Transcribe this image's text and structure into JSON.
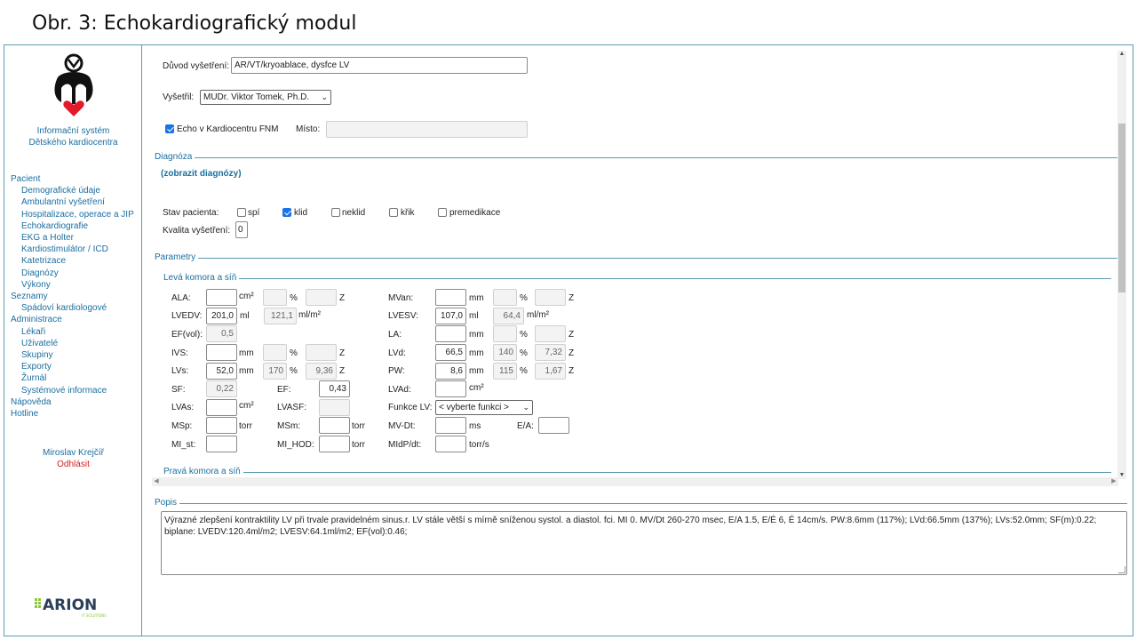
{
  "slide_title": "Obr. 3: Echokardiografický modul",
  "sidebar": {
    "system_title_1": "Informační systém",
    "system_title_2": "Dětského kardiocentra",
    "nav": [
      {
        "label": "Pacient",
        "level": 0
      },
      {
        "label": "Demografické údaje",
        "level": 1
      },
      {
        "label": "Ambulantní vyšetření",
        "level": 1
      },
      {
        "label": "Hospitalizace, operace a JIP",
        "level": 1
      },
      {
        "label": "Echokardiografie",
        "level": 1
      },
      {
        "label": "EKG a Holter",
        "level": 1
      },
      {
        "label": "Kardiostimulátor / ICD",
        "level": 1
      },
      {
        "label": "Katetrizace",
        "level": 1
      },
      {
        "label": "Diagnózy",
        "level": 1
      },
      {
        "label": "Výkony",
        "level": 1
      },
      {
        "label": "Seznamy",
        "level": 0
      },
      {
        "label": "Spádoví kardiologové",
        "level": 1
      },
      {
        "label": "Administrace",
        "level": 0
      },
      {
        "label": "Lékaři",
        "level": 1
      },
      {
        "label": "Uživatelé",
        "level": 1
      },
      {
        "label": "Skupiny",
        "level": 1
      },
      {
        "label": "Exporty",
        "level": 1
      },
      {
        "label": "Žurnál",
        "level": 1
      },
      {
        "label": "Systémové informace",
        "level": 1
      },
      {
        "label": "Nápověda",
        "level": 0
      },
      {
        "label": "Hotline",
        "level": 0
      }
    ],
    "user_name": "Miroslav Krejčíř",
    "logout": "Odhlásit",
    "vendor_logo": "ARION",
    "vendor_sub": "IT SOLUTIONS"
  },
  "form": {
    "reason_label": "Důvod vyšetření:",
    "reason_value": "AR/VT/kryoablace, dysfce LV",
    "examiner_label": "Vyšetřil:",
    "examiner_value": "MUDr. Viktor Tomek, Ph.D.",
    "echo_fnm_label": "Echo v Kardiocentru FNM",
    "echo_fnm_checked": true,
    "place_label": "Místo:",
    "place_value": "",
    "diagnoza_legend": "Diagnóza",
    "show_diagnoses": "(zobrazit diagnózy)",
    "patient_state_label": "Stav pacienta:",
    "states": [
      {
        "label": "spí",
        "checked": false
      },
      {
        "label": "klid",
        "checked": true
      },
      {
        "label": "neklid",
        "checked": false
      },
      {
        "label": "křik",
        "checked": false
      },
      {
        "label": "premedikace",
        "checked": false
      }
    ],
    "quality_label": "Kvalita vyšetření:",
    "quality_value": "0",
    "parametry_legend": "Parametry",
    "lv_legend": "Levá komora a síň",
    "rv_legend": "Pravá komora a síň",
    "popis_legend": "Popis",
    "popis_text": "Výrazné zlepšení kontraktility LV při trvale pravidelném sinus.r. LV stále větší s mírně sníženou systol. a diastol. fci. MI 0. MV/Dt 260-270 msec, E/A 1.5, E/É 6, É 14cm/s. PW:8.6mm (117%); LVd:66.5mm (137%); LVs:52.0mm; SF(m):0.22; biplane: LVEDV:120.4ml/m2; LVESV:64.1ml/m2; EF(vol):0.46;",
    "lvfunc_placeholder": "< vyberte funkci >",
    "units": {
      "cm2": "cm²",
      "ml": "ml",
      "mm": "mm",
      "pct": "%",
      "z": "Z",
      "mlm2": "ml/m²",
      "torr": "torr",
      "ms": "ms",
      "torrs": "torr/s"
    },
    "params": {
      "ALA": {
        "label": "ALA:",
        "value": "",
        "pct": "",
        "z": ""
      },
      "LVEDV": {
        "label": "LVEDV:",
        "value": "201,0",
        "index": "121,1"
      },
      "EFvol": {
        "label": "EF(vol):",
        "value": "0,5"
      },
      "IVS": {
        "label": "IVS:",
        "value": "",
        "pct": "",
        "z": ""
      },
      "LVs": {
        "label": "LVs:",
        "value": "52,0",
        "pct": "170",
        "z": "9,36"
      },
      "SF": {
        "label": "SF:",
        "value": "0,22"
      },
      "EF": {
        "label": "EF:",
        "value": "0,43"
      },
      "LVAs": {
        "label": "LVAs:",
        "value": ""
      },
      "LVASF": {
        "label": "LVASF:",
        "value": ""
      },
      "MSp": {
        "label": "MSp:",
        "value": ""
      },
      "MSm": {
        "label": "MSm:",
        "value": ""
      },
      "MI_st": {
        "label": "MI_st:",
        "value": ""
      },
      "MI_HOD": {
        "label": "MI_HOD:",
        "value": ""
      },
      "MVan": {
        "label": "MVan:",
        "value": "",
        "pct": "",
        "z": ""
      },
      "LVESV": {
        "label": "LVESV:",
        "value": "107,0",
        "index": "64,4"
      },
      "LA": {
        "label": "LA:",
        "value": "",
        "pct": "",
        "z": ""
      },
      "LVd": {
        "label": "LVd:",
        "value": "66,5",
        "pct": "140",
        "z": "7,32"
      },
      "PW": {
        "label": "PW:",
        "value": "8,6",
        "pct": "115",
        "z": "1,67"
      },
      "LVAd": {
        "label": "LVAd:",
        "value": ""
      },
      "FunkceLV": {
        "label": "Funkce LV:"
      },
      "MVDt": {
        "label": "MV-Dt:",
        "value": ""
      },
      "EA": {
        "label": "E/A:",
        "value": ""
      },
      "MIdPdt": {
        "label": "MIdP/dt:",
        "value": ""
      }
    }
  },
  "colors": {
    "accent": "#1a6fa0",
    "border": "#5b9bb0",
    "logout": "#d21f1f",
    "check": "#1a73e8"
  }
}
